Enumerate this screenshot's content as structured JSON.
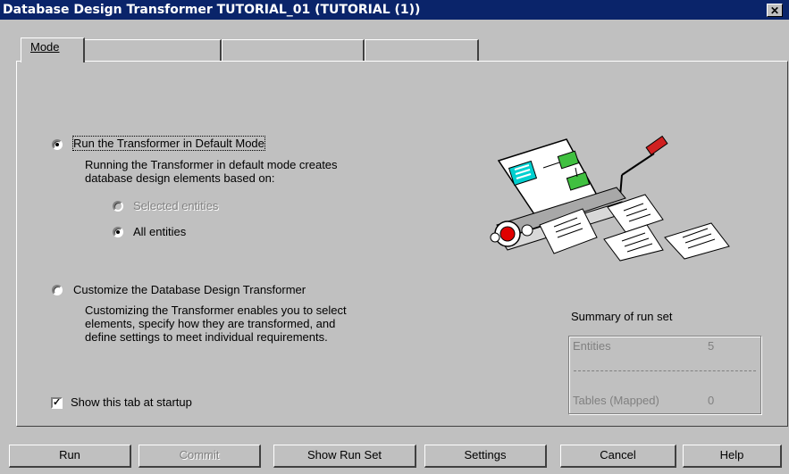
{
  "window": {
    "title": "Database Design Transformer TUTORIAL_01 (TUTORIAL (1))",
    "close": "✕"
  },
  "tabs": [
    {
      "label": "Mode"
    },
    {
      "label": ""
    },
    {
      "label": ""
    },
    {
      "label": ""
    }
  ],
  "mode": {
    "default_option": {
      "label": "Run the Transformer in Default Mode",
      "selected": true,
      "description_lines": [
        "Running the Transformer in default mode creates",
        "database design elements based on:"
      ],
      "sub_options": [
        {
          "label": "Selected entities",
          "selected": false,
          "enabled": false
        },
        {
          "label": "All entities",
          "selected": true,
          "enabled": true
        }
      ]
    },
    "custom_option": {
      "label": "Customize the Database Design Transformer",
      "selected": false,
      "description_lines": [
        "Customizing the Transformer enables you to select",
        "elements, specify how they are transformed, and",
        "define settings to meet individual requirements."
      ]
    },
    "show_at_startup": {
      "label": "Show this tab at startup",
      "checked": true
    }
  },
  "summary": {
    "title": "Summary of run set",
    "rows": [
      {
        "label": "Entities",
        "value": "5"
      },
      {
        "label": "Tables (Mapped)",
        "value": "0"
      }
    ]
  },
  "buttons": {
    "run": "Run",
    "commit": "Commit",
    "show_run_set": "Show Run Set",
    "settings": "Settings",
    "cancel": "Cancel",
    "help": "Help"
  }
}
